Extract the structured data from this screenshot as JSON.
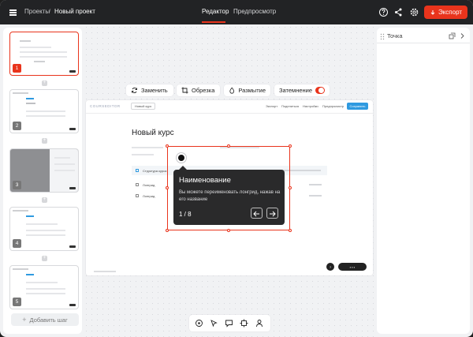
{
  "header": {
    "breadcrumb_projects": "Проекты",
    "breadcrumb_separator": "/",
    "breadcrumb_current": "Новый проект",
    "tab_editor": "Редактор",
    "tab_preview": "Предпросмотр",
    "export_label": "Экспорт",
    "icons": [
      "menu-icon",
      "help-icon",
      "share-icon",
      "settings-icon",
      "download-icon"
    ]
  },
  "steps": {
    "numbers": [
      "1",
      "2",
      "3",
      "4",
      "5"
    ],
    "active": "1",
    "add_step_label": "Добавить шаг"
  },
  "toolbar": {
    "replace_label": "Заменить",
    "crop_label": "Обрезка",
    "blur_label": "Размытие",
    "dim_label": "Затемнение",
    "dim_on": true
  },
  "slide": {
    "brand": "COURSEDITOR",
    "chip": "Новый курс",
    "nav": [
      "Экспорт",
      "Поделиться",
      "Настройки",
      "Предпросмотр"
    ],
    "save_label": "Сохранить",
    "title": "Новый курс",
    "row_header": "Структура курса",
    "rows": [
      "Лонгрид",
      "Лонгрид"
    ]
  },
  "tooltip": {
    "title": "Наименование",
    "body": "Вы можете переименовать лонгрид, нажав на его название",
    "counter": "1 / 8",
    "prev": "←",
    "next": "→"
  },
  "right_panel": {
    "title": "Точка"
  },
  "colors": {
    "accent": "#e9341c",
    "topbar": "#222325",
    "slide_accent": "#2f9ae0"
  }
}
